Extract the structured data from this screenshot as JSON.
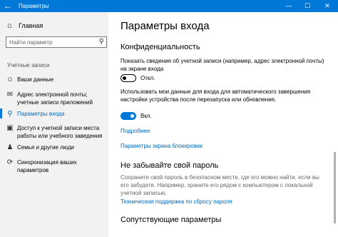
{
  "titlebar": {
    "title": "Параметры",
    "back_icon": "←",
    "minimize_icon": "—",
    "maximize_icon": "☐",
    "close_icon": "✕"
  },
  "sidebar": {
    "home_label": "Главная",
    "search_placeholder": "Найти параметр",
    "section_label": "Учетные записи",
    "items": [
      {
        "icon": "person-icon",
        "glyph": "☺",
        "label": "Ваши данные"
      },
      {
        "icon": "mail-icon",
        "glyph": "✉",
        "label": "Адрес электронной почты; учетные записи приложений"
      },
      {
        "icon": "key-icon",
        "glyph": "⚲",
        "label": "Параметры входа"
      },
      {
        "icon": "briefcase-icon",
        "glyph": "▣",
        "label": "Доступ к учетной записи места работы или учебного заведения"
      },
      {
        "icon": "family-icon",
        "glyph": "♟",
        "label": "Семья и другие люди"
      },
      {
        "icon": "sync-icon",
        "glyph": "⟳",
        "label": "Синхронизация ваших параметров"
      }
    ]
  },
  "main": {
    "title": "Параметры входа",
    "privacy": {
      "heading": "Конфиденциальность",
      "show_account_text": "Показать сведения об учетной записи (например, адрес электронной почты) на экране входа",
      "toggle1_state": "Откл.",
      "use_data_text": "Использовать мои данные для входа для автоматического завершения настройки устройства после перезапуска или обновления.",
      "toggle2_state": "Вкл.",
      "more_link": "Подробнее",
      "lockscreen_link": "Параметры экрана блокировки"
    },
    "password": {
      "heading": "Не забывайте свой пароль",
      "text": "Сохраните свой пароль в безопасном месте, где его можно найти, если вы его забудете. Например, храните его рядом с компьютером с локальной учетной записью.",
      "support_link": "Техническая поддержка по сбросу пароля"
    },
    "related": {
      "heading": "Сопутствующие параметры"
    }
  },
  "colors": {
    "accent": "#0078d7",
    "link": "#0067b8",
    "sidebar_bg": "#f2f2f2"
  }
}
